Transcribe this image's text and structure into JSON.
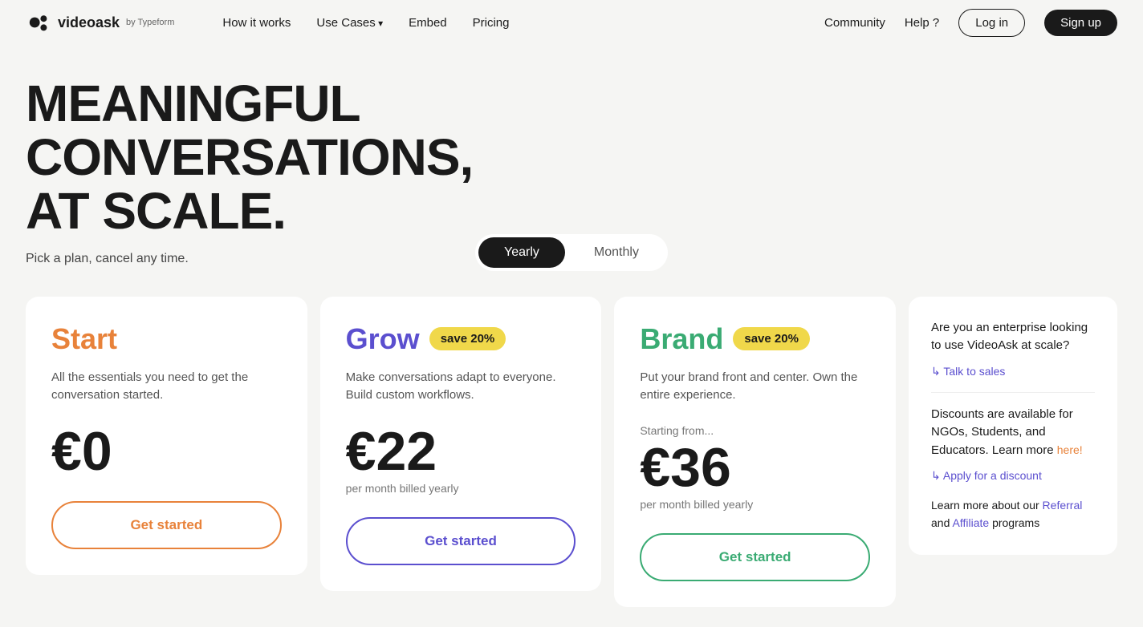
{
  "nav": {
    "logo_text": "videoask",
    "logo_by": "by Typeform",
    "links": [
      {
        "label": "How it works",
        "has_arrow": false
      },
      {
        "label": "Use Cases",
        "has_arrow": true
      },
      {
        "label": "Embed",
        "has_arrow": false
      },
      {
        "label": "Pricing",
        "has_arrow": false
      }
    ],
    "right_links": [
      {
        "label": "Community"
      },
      {
        "label": "Help ?"
      }
    ],
    "login_label": "Log in",
    "signup_label": "Sign up"
  },
  "hero": {
    "title": "MEANINGFUL CONVERSATIONS, AT SCALE.",
    "subtitle": "Pick a plan, cancel any time."
  },
  "toggle": {
    "yearly_label": "Yearly",
    "monthly_label": "Monthly"
  },
  "plans": [
    {
      "id": "start",
      "name": "Start",
      "color_class": "start",
      "save_badge": null,
      "description": "All the essentials you need to get the conversation started.",
      "price": "€0",
      "starting_from": null,
      "billing": "",
      "cta": "Get started",
      "cta_class": "start-btn"
    },
    {
      "id": "grow",
      "name": "Grow",
      "color_class": "grow",
      "save_badge": "save 20%",
      "description": "Make conversations adapt to everyone. Build custom workflows.",
      "price": "€22",
      "starting_from": null,
      "billing": "per month billed yearly",
      "cta": "Get started",
      "cta_class": "grow-btn"
    },
    {
      "id": "brand",
      "name": "Brand",
      "color_class": "brand",
      "save_badge": "save 20%",
      "description": "Put your brand front and center. Own the entire experience.",
      "price": "€36",
      "starting_from": "Starting from...",
      "billing": "per month billed yearly",
      "cta": "Get started",
      "cta_class": "brand-btn"
    }
  ],
  "enterprise": {
    "text": "Are you an enterprise looking to use VideoAsk at scale?",
    "talk_label": "Talk to sales",
    "discount_text": "Discounts are available for NGOs, Students, and Educators. Learn more",
    "discount_link_label": "here!",
    "apply_label": "Apply for a discount",
    "referral_prefix": "Learn more about our",
    "referral_label": "Referral",
    "and_text": "and",
    "affiliate_label": "Affiliate",
    "programs_text": "programs"
  }
}
